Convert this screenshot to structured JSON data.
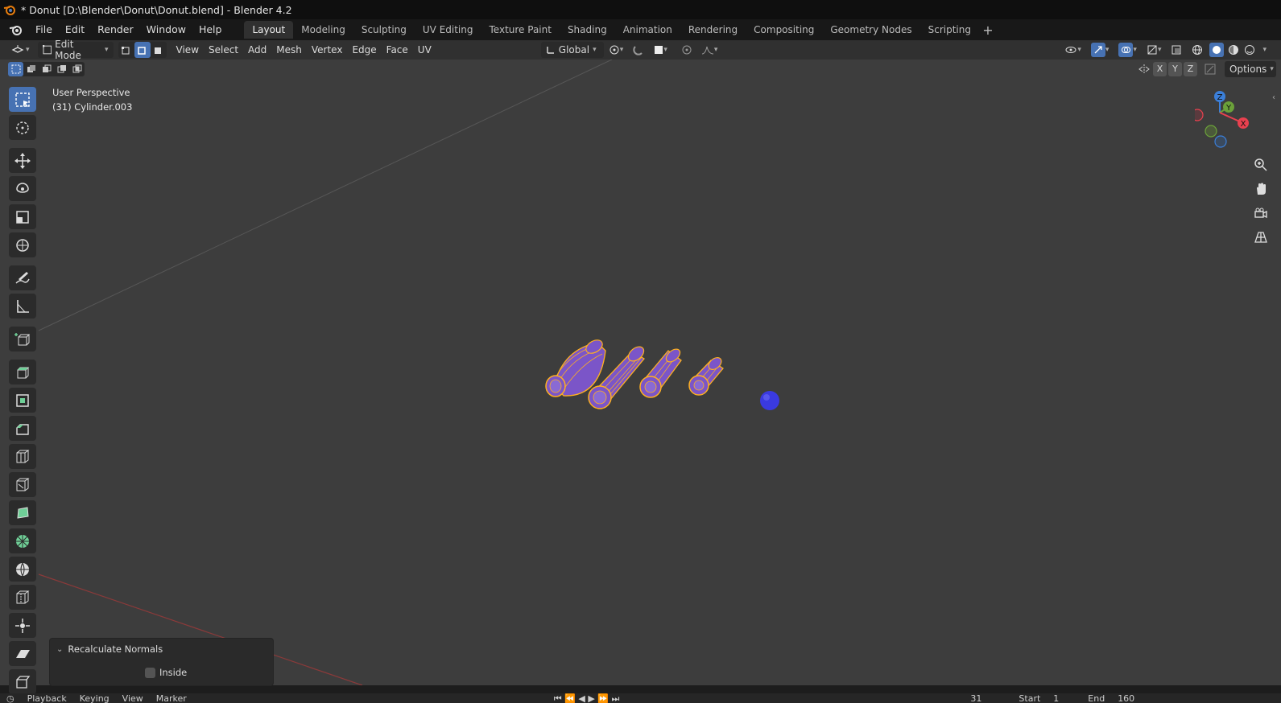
{
  "window": {
    "title": "* Donut [D:\\Blender\\Donut\\Donut.blend] - Blender 4.2"
  },
  "menu": {
    "items": [
      "File",
      "Edit",
      "Render",
      "Window",
      "Help"
    ]
  },
  "workspaces": {
    "tabs": [
      "Layout",
      "Modeling",
      "Sculpting",
      "UV Editing",
      "Texture Paint",
      "Shading",
      "Animation",
      "Rendering",
      "Compositing",
      "Geometry Nodes",
      "Scripting"
    ],
    "active": "Layout"
  },
  "header": {
    "mode": "Edit Mode",
    "menus": [
      "View",
      "Select",
      "Add",
      "Mesh",
      "Vertex",
      "Edge",
      "Face",
      "UV"
    ],
    "transform_orientation": "Global",
    "axis_labels": [
      "X",
      "Y",
      "Z"
    ],
    "options_label": "Options"
  },
  "viewport": {
    "view_name": "User Perspective",
    "object_info": "(31) Cylinder.003",
    "colors": {
      "background": "#3d3d3d",
      "mesh_fill": "#7b55c8",
      "mesh_wire": "#ffb020",
      "sphere": "#3a3ae0",
      "x_axis_line": "#8a3a3a"
    }
  },
  "gizmo": {
    "axes": [
      "Z",
      "Y",
      "X"
    ],
    "colors": {
      "x": "#e8414f",
      "y": "#6ba13a",
      "z": "#3b7fd9"
    }
  },
  "operator_panel": {
    "title": "Recalculate Normals",
    "checkbox_label": "Inside",
    "checkbox_checked": false
  },
  "timeline": {
    "items": [
      "Playback",
      "Keying",
      "View",
      "Marker"
    ],
    "current_frame": "31",
    "start_label": "Start",
    "start_value": "1",
    "end_label": "End",
    "end_value": "160"
  }
}
